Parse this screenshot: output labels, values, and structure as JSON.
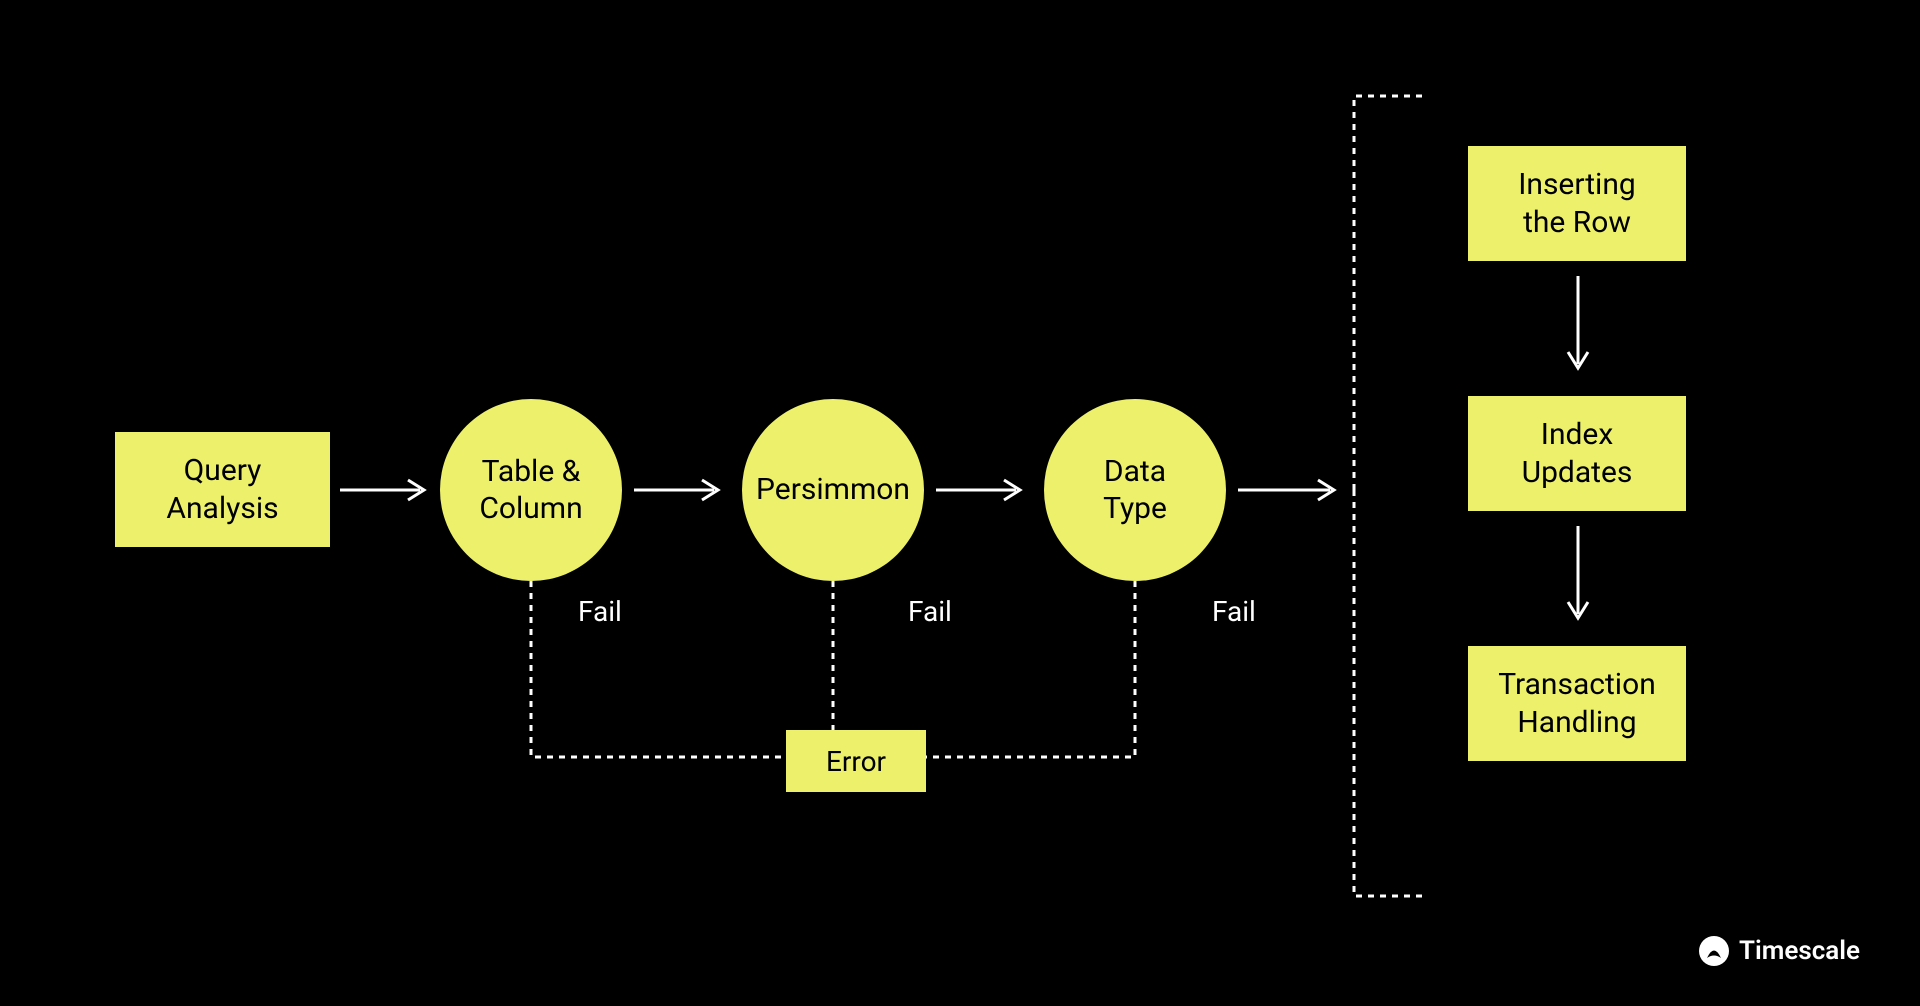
{
  "nodes": {
    "query_analysis": "Query\nAnalysis",
    "table_column": "Table &\nColumn",
    "persimmon": "Persimmon",
    "data_type": "Data\nType",
    "error": "Error",
    "inserting_row": "Inserting\nthe Row",
    "index_updates": "Index\nUpdates",
    "transaction_handling": "Transaction\nHandling"
  },
  "labels": {
    "fail1": "Fail",
    "fail2": "Fail",
    "fail3": "Fail"
  },
  "branding": {
    "name": "Timescale"
  },
  "colors": {
    "bg": "#000000",
    "accent": "#ecf06a",
    "text": "#ffffff"
  }
}
